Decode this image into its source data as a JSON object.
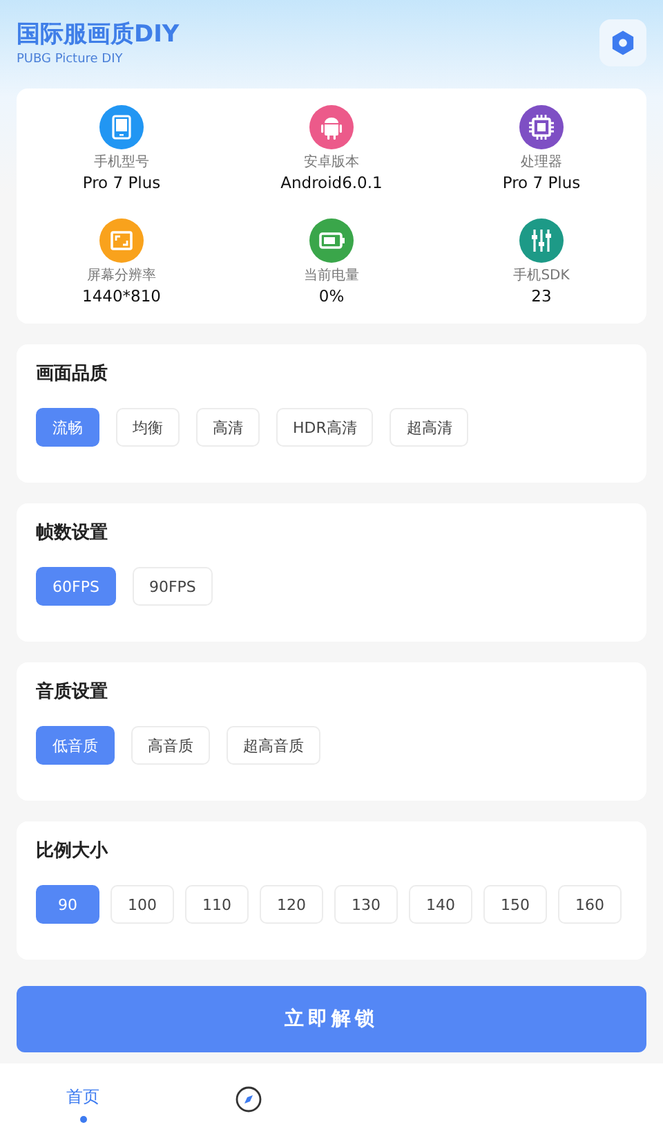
{
  "header": {
    "title": "国际服画质DIY",
    "subtitle": "PUBG Picture DIY"
  },
  "device_info": [
    {
      "kind": "phone",
      "label": "手机型号",
      "value": "Pro 7 Plus"
    },
    {
      "kind": "android",
      "label": "安卓版本",
      "value": "Android6.0.1"
    },
    {
      "kind": "cpu",
      "label": "处理器",
      "value": "Pro 7 Plus"
    },
    {
      "kind": "screen",
      "label": "屏幕分辨率",
      "value": "1440*810"
    },
    {
      "kind": "battery",
      "label": "当前电量",
      "value": "0%"
    },
    {
      "kind": "sdk",
      "label": "手机SDK",
      "value": "23"
    }
  ],
  "sections": [
    {
      "title": "画面品质",
      "options": [
        {
          "label": "流畅",
          "selected": true
        },
        {
          "label": "均衡",
          "selected": false
        },
        {
          "label": "高清",
          "selected": false
        },
        {
          "label": "HDR高清",
          "selected": false
        },
        {
          "label": "超高清",
          "selected": false
        }
      ]
    },
    {
      "title": "帧数设置",
      "options": [
        {
          "label": "60FPS",
          "selected": true
        },
        {
          "label": "90FPS",
          "selected": false
        }
      ]
    },
    {
      "title": "音质设置",
      "options": [
        {
          "label": "低音质",
          "selected": true
        },
        {
          "label": "高音质",
          "selected": false
        },
        {
          "label": "超高音质",
          "selected": false
        }
      ]
    },
    {
      "title": "比例大小",
      "options": [
        {
          "label": "90",
          "selected": true
        },
        {
          "label": "100",
          "selected": false
        },
        {
          "label": "110",
          "selected": false
        },
        {
          "label": "120",
          "selected": false
        },
        {
          "label": "130",
          "selected": false
        },
        {
          "label": "140",
          "selected": false
        },
        {
          "label": "150",
          "selected": false
        },
        {
          "label": "160",
          "selected": false
        }
      ]
    }
  ],
  "unlock_button": "立即解锁",
  "bottom_nav": [
    {
      "kind": "text",
      "label": "首页",
      "selected": true
    },
    {
      "kind": "compass",
      "selected": false
    }
  ]
}
